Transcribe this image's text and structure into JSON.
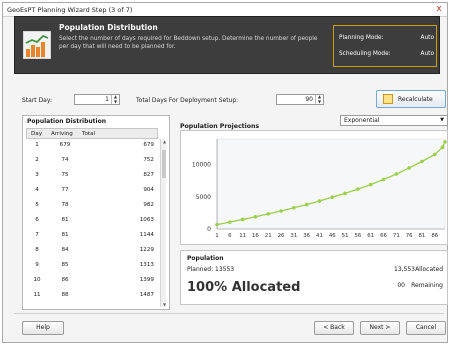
{
  "window": {
    "title": "GeoEsPT Planning Wizard Step (3 of 7)",
    "close_glyph": "x"
  },
  "header": {
    "title": "Population Distribution",
    "description": "Select the number of days required for Beddown setup. Determine the number of people per day that will need to be planned for.",
    "planning_mode_label": "Planning Mode:",
    "planning_mode_value": "Auto",
    "scheduling_mode_label": "Scheduling Mode:",
    "scheduling_mode_value": "Auto"
  },
  "controls": {
    "start_day_label": "Start Day:",
    "start_day_value": "1",
    "total_days_label": "Total Days For Deployment Setup:",
    "total_days_value": "90",
    "recalculate_label": "Recalculate"
  },
  "population_distribution": {
    "title": "Population Distribution",
    "columns": [
      "Day",
      "Arriving",
      "Total"
    ],
    "rows": [
      [
        "1",
        "679",
        "679"
      ],
      [
        "2",
        "74",
        "752"
      ],
      [
        "3",
        "75",
        "827"
      ],
      [
        "4",
        "77",
        "904"
      ],
      [
        "5",
        "78",
        "982"
      ],
      [
        "6",
        "81",
        "1063"
      ],
      [
        "7",
        "81",
        "1144"
      ],
      [
        "8",
        "84",
        "1229"
      ],
      [
        "9",
        "85",
        "1313"
      ],
      [
        "10",
        "86",
        "1399"
      ],
      [
        "11",
        "88",
        "1487"
      ]
    ]
  },
  "projections": {
    "title": "Population Projections",
    "model_selected": "Exponential"
  },
  "chart_data": {
    "type": "line",
    "title": "",
    "x": [
      1,
      6,
      11,
      16,
      21,
      26,
      31,
      36,
      41,
      46,
      51,
      56,
      61,
      66,
      71,
      76,
      81,
      86
    ],
    "x_tick_labels": [
      "1",
      "6",
      "11",
      "16",
      "21",
      "26",
      "31",
      "36",
      "41",
      "46",
      "51",
      "56",
      "61",
      "66",
      "71",
      "76",
      "81",
      "86"
    ],
    "y_ticks": [
      0,
      5000,
      10000
    ],
    "ylim": [
      0,
      14000
    ],
    "xlim": [
      1,
      90
    ],
    "grid": false,
    "series": [
      {
        "values": [
          679,
          1063,
          1487,
          1900,
          2350,
          2800,
          3300,
          3800,
          4350,
          4950,
          5550,
          6200,
          6900,
          7700,
          8550,
          9500,
          10500,
          11600,
          12700,
          13553
        ]
      }
    ],
    "series_x": [
      1,
      6,
      11,
      16,
      21,
      26,
      31,
      36,
      41,
      46,
      51,
      56,
      61,
      66,
      71,
      76,
      81,
      86,
      89,
      90
    ],
    "line_color": "#9bcf4c",
    "marker_color": "#9bcf4c"
  },
  "allocation": {
    "title": "Population",
    "planned": "Planned: 13553",
    "percent_label": "100% Allocated",
    "allocated_value": "13,553",
    "allocated_label": "Allocated",
    "remaining_value": "00",
    "remaining_label": "Remaining"
  },
  "footer": {
    "help_label": "Help",
    "back_label": "< Back",
    "next_label": "Next >",
    "cancel_label": "Cancel"
  }
}
